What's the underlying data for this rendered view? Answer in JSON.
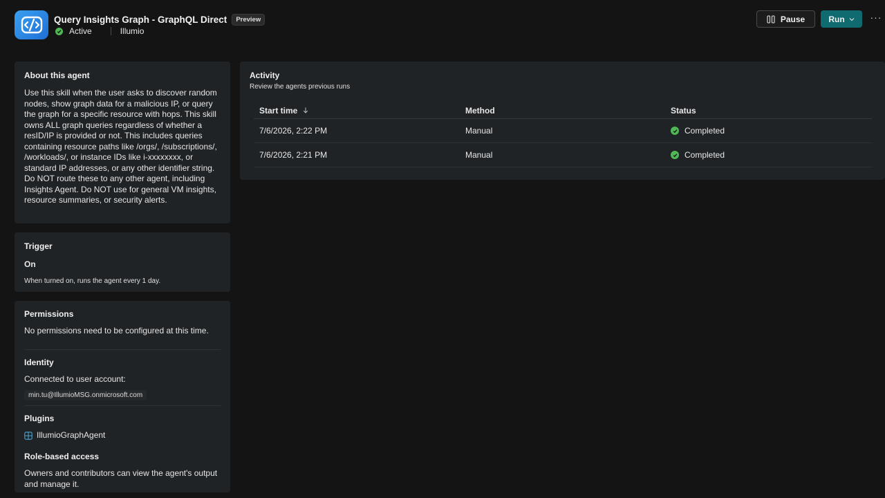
{
  "header": {
    "title": "Query Insights Graph - GraphQL Direct",
    "badge": "Preview",
    "status": "Active",
    "publisher": "Illumio",
    "pause_label": "Pause",
    "run_label": "Run",
    "more_label": "···"
  },
  "about": {
    "heading": "About this agent",
    "description": "Use this skill when the user asks to discover random nodes, show graph data for a malicious IP, or query the graph for a specific resource with hops. This skill owns ALL graph queries regardless of whether a resID/IP is provided or not. This includes queries containing resource paths like /orgs/, /subscriptions/, /workloads/, or instance IDs like i-xxxxxxxx, or standard IP addresses, or any other identifier string. Do NOT route these to any other agent, including Insights Agent. Do NOT use for general VM insights, resource summaries, or security alerts."
  },
  "trigger": {
    "heading": "Trigger",
    "state": "On",
    "description": "When turned on, runs the agent every 1 day."
  },
  "permissions": {
    "heading": "Permissions",
    "text": "No permissions need to be configured at this time."
  },
  "identity": {
    "heading": "Identity",
    "label": "Connected to user account:",
    "account": "min.tu@IllumioMSG.onmicrosoft.com"
  },
  "plugins": {
    "heading": "Plugins",
    "items": [
      "IllumioGraphAgent"
    ]
  },
  "rbac": {
    "heading": "Role-based access",
    "text": "Owners and contributors can view the agent's output and manage it."
  },
  "activity": {
    "heading": "Activity",
    "subtitle": "Review the agents previous runs",
    "columns": [
      "Start time",
      "Method",
      "Status"
    ],
    "rows": [
      {
        "start_time": "7/6/2026, 2:22 PM",
        "method": "Manual",
        "status": "Completed"
      },
      {
        "start_time": "7/6/2026, 2:21 PM",
        "method": "Manual",
        "status": "Completed"
      }
    ]
  },
  "colors": {
    "background": "#141414",
    "card": "#202326",
    "accent": "#0f6b6f",
    "success": "#4fb854",
    "logo": "#2a85e6"
  }
}
